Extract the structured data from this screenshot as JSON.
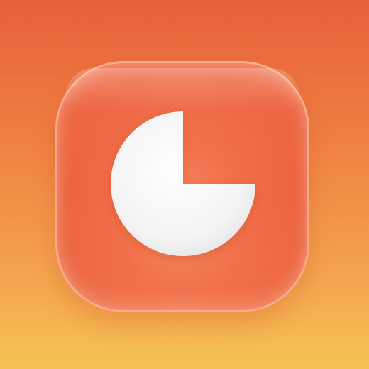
{
  "app_icon": {
    "icon_name": "pie-chart-icon",
    "background_colors": [
      "#e8603b",
      "#f6c256"
    ],
    "tile_color": "#ec6340",
    "glyph_color": "#f4f4f4"
  },
  "chart_data": {
    "type": "pie",
    "values": [
      75,
      25
    ],
    "colors": [
      "#f4f4f4",
      "transparent"
    ]
  }
}
